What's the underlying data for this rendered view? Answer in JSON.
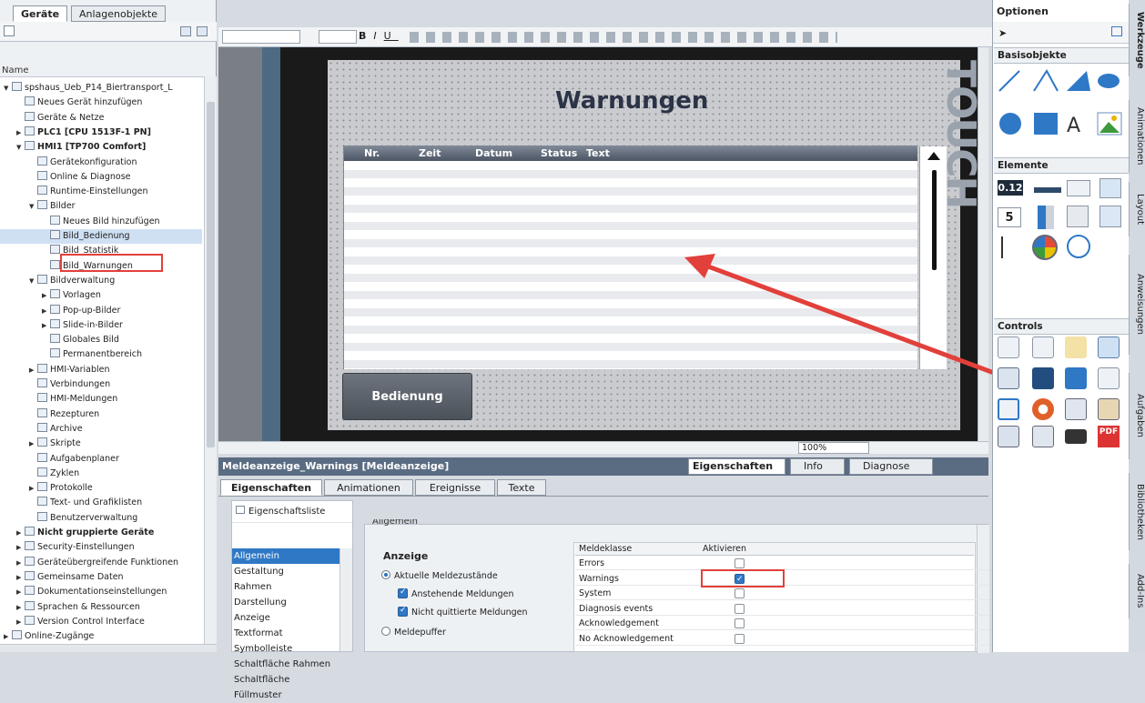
{
  "left_tabs": [
    "Geräte",
    "Anlagenobjekte"
  ],
  "tree_header": "Name",
  "tree": [
    {
      "label": "spshaus_Ueb_P14_Biertransport_L",
      "level": 0,
      "tw": "▼"
    },
    {
      "label": "Neues Gerät hinzufügen",
      "level": 1,
      "tw": ""
    },
    {
      "label": "Geräte & Netze",
      "level": 1,
      "tw": ""
    },
    {
      "label": "PLC1 [CPU 1513F-1 PN]",
      "level": 1,
      "tw": "▶",
      "bold": true
    },
    {
      "label": "HMI1 [TP700 Comfort]",
      "level": 1,
      "tw": "▼",
      "bold": true
    },
    {
      "label": "Gerätekonfiguration",
      "level": 2,
      "tw": ""
    },
    {
      "label": "Online & Diagnose",
      "level": 2,
      "tw": ""
    },
    {
      "label": "Runtime-Einstellungen",
      "level": 2,
      "tw": ""
    },
    {
      "label": "Bilder",
      "level": 2,
      "tw": "▼"
    },
    {
      "label": "Neues Bild hinzufügen",
      "level": 3,
      "tw": ""
    },
    {
      "label": "Bild_Bedienung",
      "level": 3,
      "tw": ""
    },
    {
      "label": "Bild_Statistik",
      "level": 3,
      "tw": ""
    },
    {
      "label": "Bild_Warnungen",
      "level": 3,
      "tw": ""
    },
    {
      "label": "Bildverwaltung",
      "level": 2,
      "tw": "▼"
    },
    {
      "label": "Vorlagen",
      "level": 3,
      "tw": "▶"
    },
    {
      "label": "Pop-up-Bilder",
      "level": 3,
      "tw": "▶"
    },
    {
      "label": "Slide-in-Bilder",
      "level": 3,
      "tw": "▶"
    },
    {
      "label": "Globales Bild",
      "level": 3,
      "tw": ""
    },
    {
      "label": "Permanentbereich",
      "level": 3,
      "tw": ""
    },
    {
      "label": "HMI-Variablen",
      "level": 2,
      "tw": "▶"
    },
    {
      "label": "Verbindungen",
      "level": 2,
      "tw": ""
    },
    {
      "label": "HMI-Meldungen",
      "level": 2,
      "tw": ""
    },
    {
      "label": "Rezepturen",
      "level": 2,
      "tw": ""
    },
    {
      "label": "Archive",
      "level": 2,
      "tw": ""
    },
    {
      "label": "Skripte",
      "level": 2,
      "tw": "▶"
    },
    {
      "label": "Aufgabenplaner",
      "level": 2,
      "tw": ""
    },
    {
      "label": "Zyklen",
      "level": 2,
      "tw": ""
    },
    {
      "label": "Protokolle",
      "level": 2,
      "tw": "▶"
    },
    {
      "label": "Text- und Grafiklisten",
      "level": 2,
      "tw": ""
    },
    {
      "label": "Benutzerverwaltung",
      "level": 2,
      "tw": ""
    },
    {
      "label": "Nicht gruppierte Geräte",
      "level": 1,
      "tw": "▶",
      "bold": true
    },
    {
      "label": "Security-Einstellungen",
      "level": 1,
      "tw": "▶"
    },
    {
      "label": "Geräteübergreifende Funktionen",
      "level": 1,
      "tw": "▶"
    },
    {
      "label": "Gemeinsame Daten",
      "level": 1,
      "tw": "▶"
    },
    {
      "label": "Dokumentationseinstellungen",
      "level": 1,
      "tw": "▶"
    },
    {
      "label": "Sprachen & Ressourcen",
      "level": 1,
      "tw": "▶"
    },
    {
      "label": "Version Control Interface",
      "level": 1,
      "tw": "▶"
    },
    {
      "label": "Online-Zugänge",
      "level": 0,
      "tw": "▶"
    }
  ],
  "screen": {
    "title": "Warnungen",
    "columns": [
      "Nr.",
      "Zeit",
      "Datum",
      "Status",
      "Text"
    ],
    "button_label": "Bedienung",
    "side_text": "TOUCH"
  },
  "zoom": "100%",
  "inspector": {
    "object_title": "Meldeanzeige_Warnings [Meldeanzeige]",
    "view_tabs": [
      "Eigenschaften",
      "Info",
      "Diagnose"
    ],
    "tabs": [
      "Eigenschaften",
      "Animationen",
      "Ereignisse",
      "Texte"
    ],
    "props_list_label": "Eigenschaftsliste",
    "props": [
      "Allgemein",
      "Gestaltung",
      "Rahmen",
      "Darstellung",
      "Anzeige",
      "Textformat",
      "Symbolleiste",
      "Schaltfläche Rahmen",
      "Schaltfläche Füllmuster"
    ],
    "section_cut": "Allgemein",
    "section": "Anzeige",
    "radio1": "Aktuelle Meldezustände",
    "check1": "Anstehende Meldungen",
    "check2": "Nicht quittierte Meldungen",
    "radio2": "Meldepuffer",
    "table_headers": [
      "Meldeklasse",
      "Aktivieren"
    ],
    "classes": [
      {
        "name": "Errors",
        "active": false
      },
      {
        "name": "Warnings",
        "active": true
      },
      {
        "name": "System",
        "active": false
      },
      {
        "name": "Diagnosis events",
        "active": false
      },
      {
        "name": "Acknowledgement",
        "active": false
      },
      {
        "name": "No Acknowledgement",
        "active": false
      }
    ]
  },
  "right": {
    "header": "Optionen",
    "sections": [
      "Basisobjekte",
      "Elemente",
      "Controls"
    ],
    "basis_text_tool": "A",
    "element_value": "0.12",
    "element_digit": "5",
    "pdf": "PDF"
  },
  "vertical_tabs": [
    "Werkzeuge",
    "Animationen",
    "Layout",
    "Anweisungen",
    "Aufgaben",
    "Bibliotheken",
    "Add-Ins"
  ]
}
